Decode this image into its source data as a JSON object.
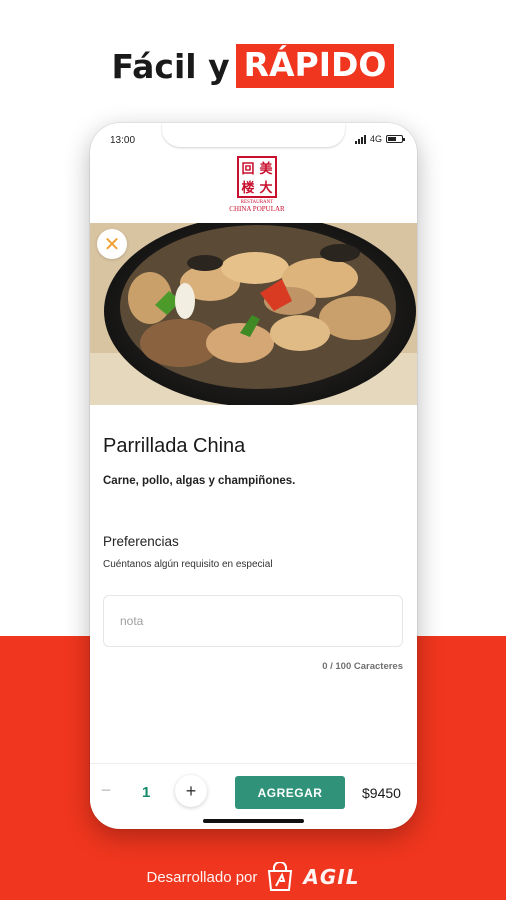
{
  "headline": {
    "plain": "Fácil y",
    "highlight": "RÁPIDO"
  },
  "status_bar": {
    "time": "13:00",
    "network": "4G"
  },
  "logo": {
    "line1": "RESTAURANT",
    "line2": "CHINA POPULAR"
  },
  "dish": {
    "name": "Parrillada China",
    "description": "Carne, pollo, algas y champiñones."
  },
  "preferences": {
    "title": "Preferencias",
    "subtitle": "Cuéntanos algún requisito en especial",
    "note_placeholder": "nota",
    "char_count": "0 / 100 Caracteres"
  },
  "cart": {
    "minus_icon": "−",
    "quantity": "1",
    "plus_icon": "+",
    "add_label": "AGREGAR",
    "price": "$9450"
  },
  "footer": {
    "text": "Desarrollado por",
    "brand": "AGIL"
  },
  "colors": {
    "brand_red": "#f0361e",
    "accent_green": "#2f9279",
    "close_orange": "#f0a030"
  },
  "icons": {
    "close": "close-icon",
    "minus": "minus-icon",
    "plus": "plus-icon"
  }
}
